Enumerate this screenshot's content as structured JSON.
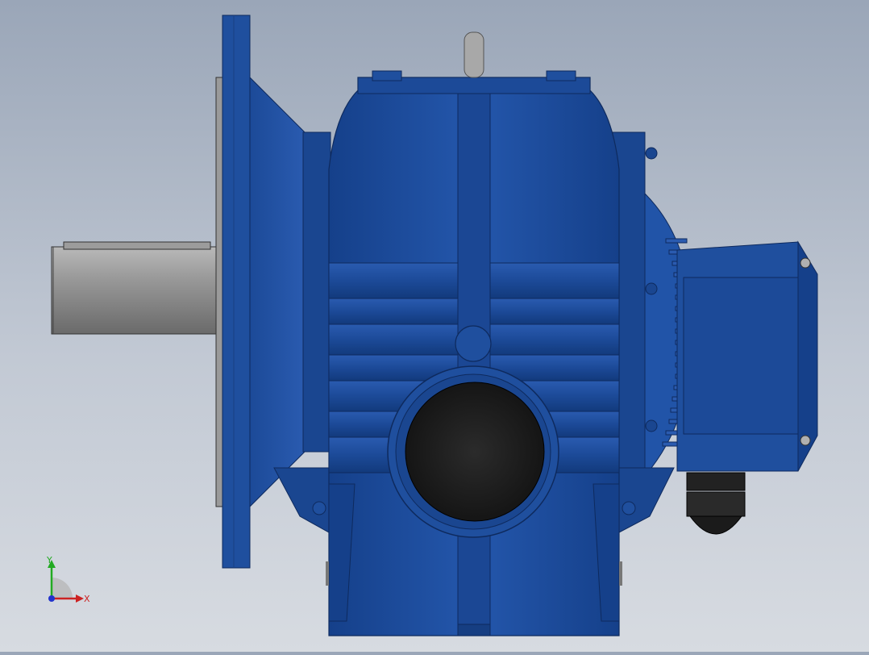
{
  "viewport": {
    "background_top": "#9aa6b8",
    "background_bottom": "#d7dbe1"
  },
  "model": {
    "body_color": "#1f4f9e",
    "body_dark": "#123472",
    "shaft_color": "#8e8e8e",
    "bore_color": "#1a1a1a",
    "gland_color": "#222222"
  },
  "triad": {
    "x_label": "X",
    "y_label": "Y",
    "x_color": "#cc2222",
    "y_color": "#22aa22",
    "z_color": "#2233cc"
  }
}
